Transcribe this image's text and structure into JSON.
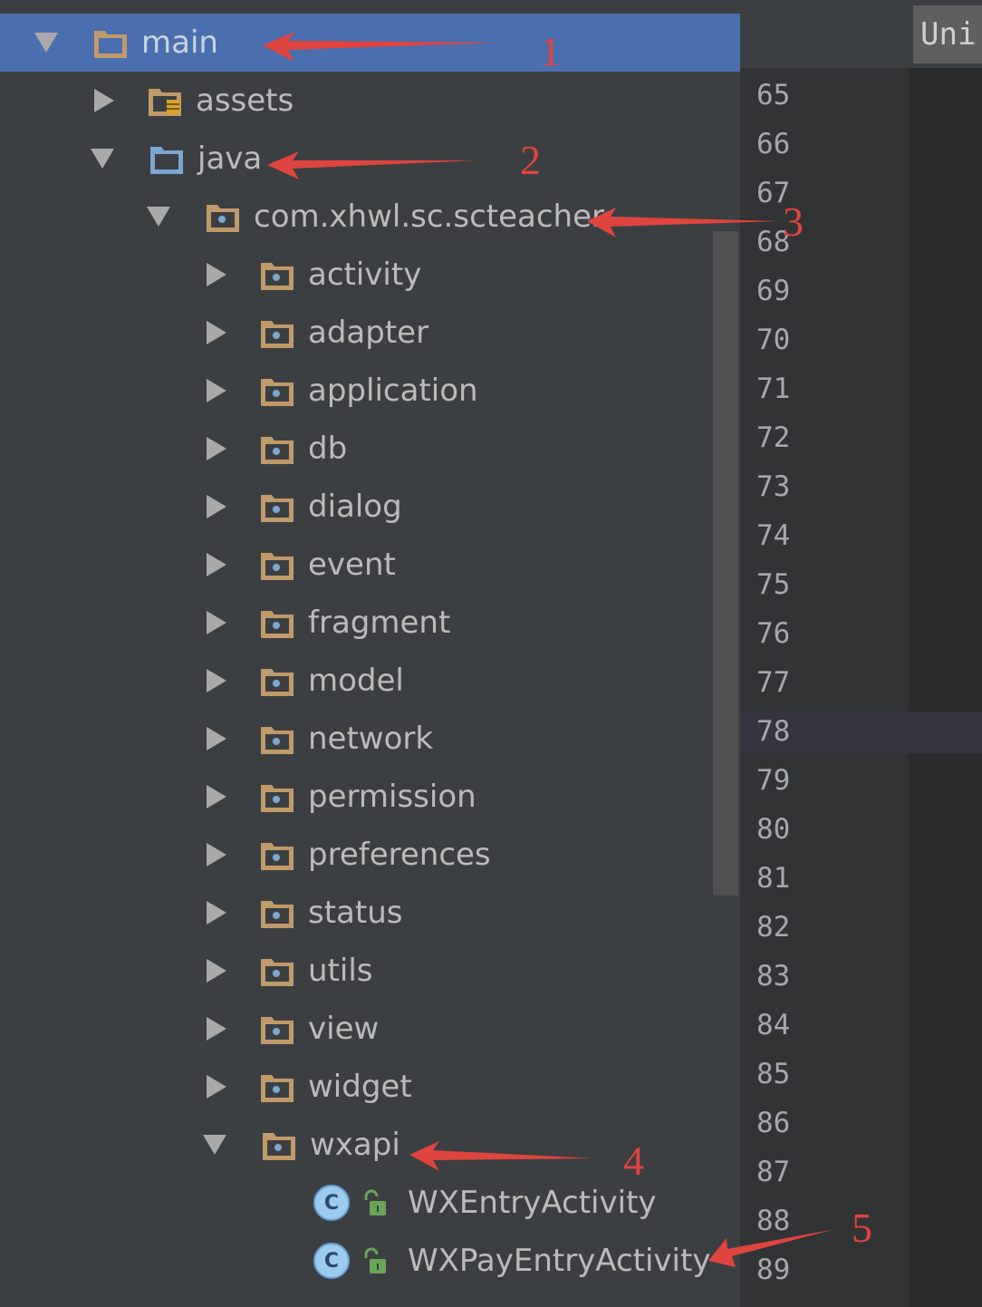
{
  "tree": {
    "items": [
      {
        "label": "main",
        "depth": 0,
        "expanded": true,
        "selected": true,
        "icon": "module-folder-icon"
      },
      {
        "label": "assets",
        "depth": 1,
        "expanded": false,
        "icon": "assets-folder-icon"
      },
      {
        "label": "java",
        "depth": 1,
        "expanded": true,
        "icon": "source-folder-icon"
      },
      {
        "label": "com.xhwl.sc.scteacher",
        "depth": 2,
        "expanded": true,
        "icon": "package-icon"
      },
      {
        "label": "activity",
        "depth": 3,
        "expanded": false,
        "icon": "package-icon"
      },
      {
        "label": "adapter",
        "depth": 3,
        "expanded": false,
        "icon": "package-icon"
      },
      {
        "label": "application",
        "depth": 3,
        "expanded": false,
        "icon": "package-icon"
      },
      {
        "label": "db",
        "depth": 3,
        "expanded": false,
        "icon": "package-icon"
      },
      {
        "label": "dialog",
        "depth": 3,
        "expanded": false,
        "icon": "package-icon"
      },
      {
        "label": "event",
        "depth": 3,
        "expanded": false,
        "icon": "package-icon"
      },
      {
        "label": "fragment",
        "depth": 3,
        "expanded": false,
        "icon": "package-icon"
      },
      {
        "label": "model",
        "depth": 3,
        "expanded": false,
        "icon": "package-icon"
      },
      {
        "label": "network",
        "depth": 3,
        "expanded": false,
        "icon": "package-icon"
      },
      {
        "label": "permission",
        "depth": 3,
        "expanded": false,
        "icon": "package-icon"
      },
      {
        "label": "preferences",
        "depth": 3,
        "expanded": false,
        "icon": "package-icon"
      },
      {
        "label": "status",
        "depth": 3,
        "expanded": false,
        "icon": "package-icon"
      },
      {
        "label": "utils",
        "depth": 3,
        "expanded": false,
        "icon": "package-icon"
      },
      {
        "label": "view",
        "depth": 3,
        "expanded": false,
        "icon": "package-icon"
      },
      {
        "label": "widget",
        "depth": 3,
        "expanded": false,
        "icon": "package-icon"
      },
      {
        "label": "wxapi",
        "depth": 3,
        "expanded": true,
        "icon": "package-icon"
      },
      {
        "label": "WXEntryActivity",
        "depth": 4,
        "icon": "class-icon",
        "class_letter": "C"
      },
      {
        "label": "WXPayEntryActivity",
        "depth": 4,
        "icon": "class-icon",
        "class_letter": "C"
      }
    ]
  },
  "editor": {
    "tab_label": "Uni",
    "line_numbers": [
      "65",
      "66",
      "67",
      "68",
      "69",
      "70",
      "71",
      "72",
      "73",
      "74",
      "75",
      "76",
      "77",
      "78",
      "79",
      "80",
      "81",
      "82",
      "83",
      "84",
      "85",
      "86",
      "87",
      "88",
      "89"
    ],
    "current_line": "78"
  },
  "annotations": [
    "1",
    "2",
    "3",
    "4",
    "5"
  ],
  "colors": {
    "selection": "#4b6eaf",
    "annotation": "#e0443e",
    "folder": "#c09a6b",
    "source_folder": "#7ba7d0"
  }
}
